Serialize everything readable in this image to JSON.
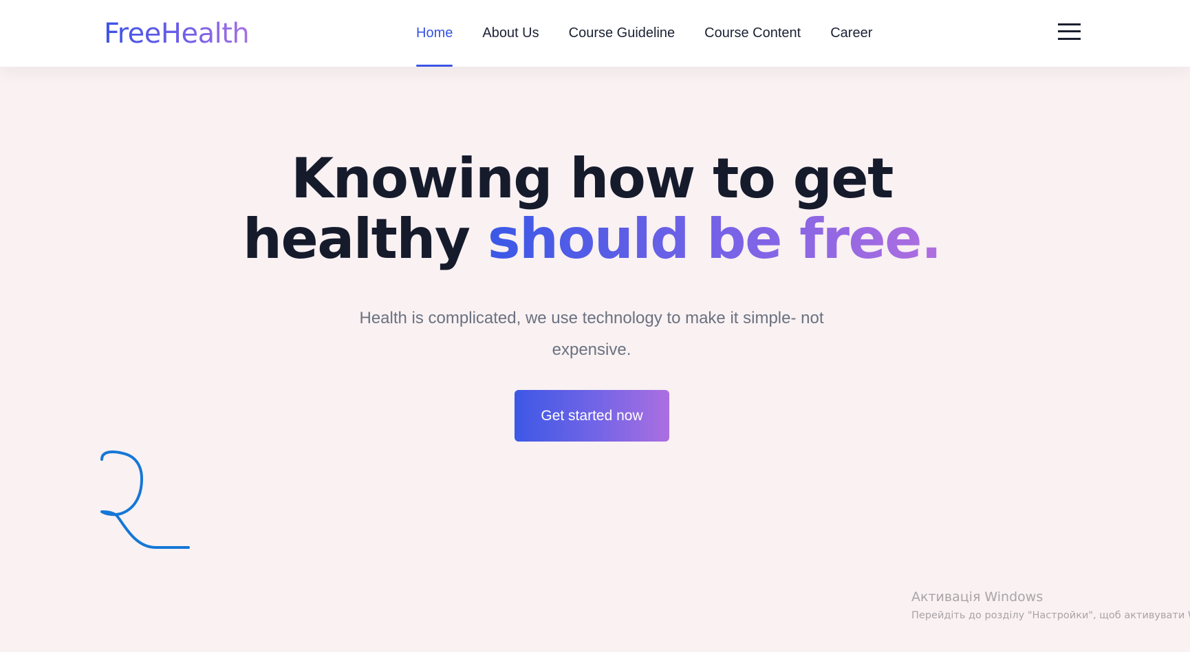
{
  "header": {
    "logo": "FreeHealth",
    "nav": [
      {
        "label": "Home",
        "active": true
      },
      {
        "label": "About Us"
      },
      {
        "label": "Course Guideline"
      },
      {
        "label": "Course Content"
      },
      {
        "label": "Career"
      }
    ],
    "menu_icon": "hamburger-menu-icon"
  },
  "hero": {
    "title_line1": "Knowing how to get",
    "title_line2_plain": "healthy",
    "title_line2_accent": "should be free.",
    "subtitle": "Health is complicated, we use technology to make it simple- not expensive.",
    "cta_label": "Get started now"
  },
  "watermark": {
    "title": "Активація Windows",
    "text": "Перейдіть до розділу \"Настройки\", щоб активувати Windo"
  },
  "colors": {
    "accent_blue": "#3b52e4",
    "accent_purple": "#a671e4",
    "text_dark": "#161b2c",
    "page_bg": "#f9f1f2",
    "annotation": "#1577d6"
  }
}
